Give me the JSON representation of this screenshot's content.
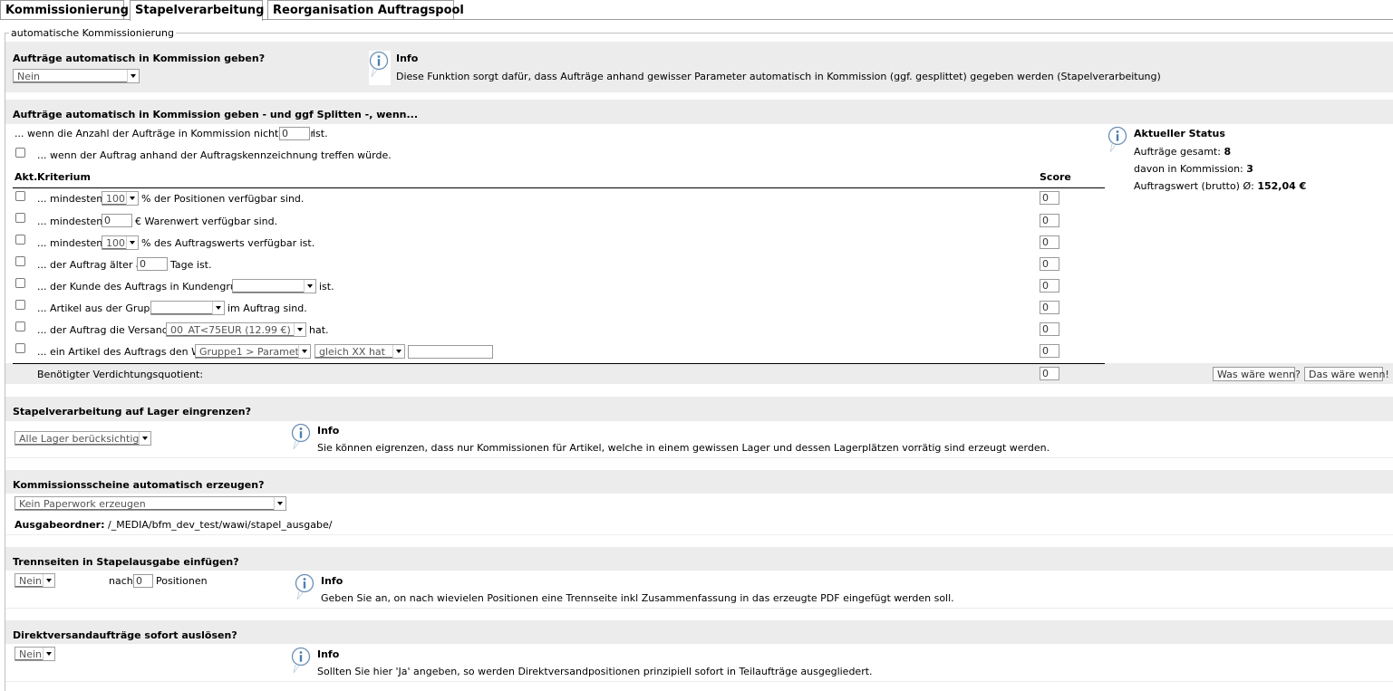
{
  "tabs": [
    "Kommissionierung",
    "Stapelverarbeitung",
    "Reorganisation Auftragspool"
  ],
  "legend": "automatische Kommissionierung",
  "auto": {
    "heading": "Aufträge automatisch in Kommission geben?",
    "select_value": "Nein",
    "info_title": "Info",
    "info_text": "Diese Funktion sorgt dafür, dass Aufträge anhand gewisser Parameter automatisch in Kommission (ggf. gesplittet) gegeben werden (Stapelverarbeitung)"
  },
  "criteria": {
    "heading": "Aufträge automatisch in Kommission geben - und ggf Splitten -, wenn...",
    "max_orders_before": "... wenn die Anzahl der Aufträge in Kommission nicht größer",
    "max_orders_value": "0",
    "max_orders_after": "ist.",
    "kennzeichnung_text": "... wenn der Auftrag anhand der Auftragskennzeichnung treffen würde.",
    "col_active": "Akt.",
    "col_criterion": "Kriterium",
    "col_score": "Score",
    "rows": [
      {
        "before": "... mindestens",
        "select": "100",
        "after": "% der Positionen verfügbar sind.",
        "score": "0"
      },
      {
        "before": "... mindestens",
        "input": "0",
        "after": "€ Warenwert verfügbar sind.",
        "score": "0"
      },
      {
        "before": "... mindestens",
        "select": "100",
        "after": "% des Auftragswerts verfügbar ist.",
        "score": "0"
      },
      {
        "before": "... der Auftrag älter als",
        "input": "0",
        "after": "Tage ist.",
        "score": "0"
      },
      {
        "before": "... der Kunde des Auftrags in Kundengruppe",
        "select": "",
        "after": "ist.",
        "score": "0"
      },
      {
        "before": "... Artikel aus der Gruppe",
        "select": "",
        "after": "im Auftrag sind.",
        "score": "0"
      },
      {
        "before": "... der Auftrag die Versandart",
        "select": "00_AT<75EUR (12.99 €)",
        "after": "hat.",
        "score": "0"
      },
      {
        "before": "... ein Artikel des Auftrags den Wert",
        "select": "Gruppe1 > Parameter",
        "select2": "gleich XX hat",
        "input": "",
        "score": "0"
      }
    ],
    "quotient_label": "Benötigter Verdichtungsquotient:",
    "quotient_value": "0",
    "btn_what_if": "Was wäre wenn?",
    "btn_would_be": "Das wäre wenn!"
  },
  "status": {
    "title": "Aktueller Status",
    "total_label": "Aufträge gesamt:",
    "total_value": "8",
    "in_commission_label": "davon in Kommission:",
    "in_commission_value": "3",
    "avg_label": "Auftragswert (brutto) Ø:",
    "avg_value": "152,04 €"
  },
  "lager": {
    "heading": "Stapelverarbeitung auf Lager eingrenzen?",
    "select_value": "Alle Lager berücksichtigen",
    "info_title": "Info",
    "info_text": "Sie können eigrenzen, dass nur Kommissionen für Artikel, welche in einem gewissen Lager und dessen Lagerplätzen vorrätig sind erzeugt werden."
  },
  "paperwork": {
    "heading": "Kommissionsscheine automatisch erzeugen?",
    "select_value": "Kein Paperwork erzeugen",
    "folder_label": "Ausgabeordner:",
    "folder_value": "/_MEDIA/bfm_dev_test/wawi/stapel_ausgabe/"
  },
  "trenn": {
    "heading": "Trennseiten in Stapelausgabe einfügen?",
    "select_value": "Nein",
    "after_label": "nach",
    "positions_value": "0",
    "positions_label": "Positionen",
    "info_title": "Info",
    "info_text": "Geben Sie an, on nach wievielen Positionen eine Trennseite inkl Zusammenfassung in das erzeugte PDF eingefügt werden soll."
  },
  "direkt": {
    "heading": "Direktversandaufträge sofort auslösen?",
    "select_value": "Nein",
    "info_title": "Info",
    "info_text": "Sollten Sie hier 'Ja' angeben, so werden Direktversandpositionen prinzipiell sofort in Teilaufträge ausgegliedert."
  }
}
